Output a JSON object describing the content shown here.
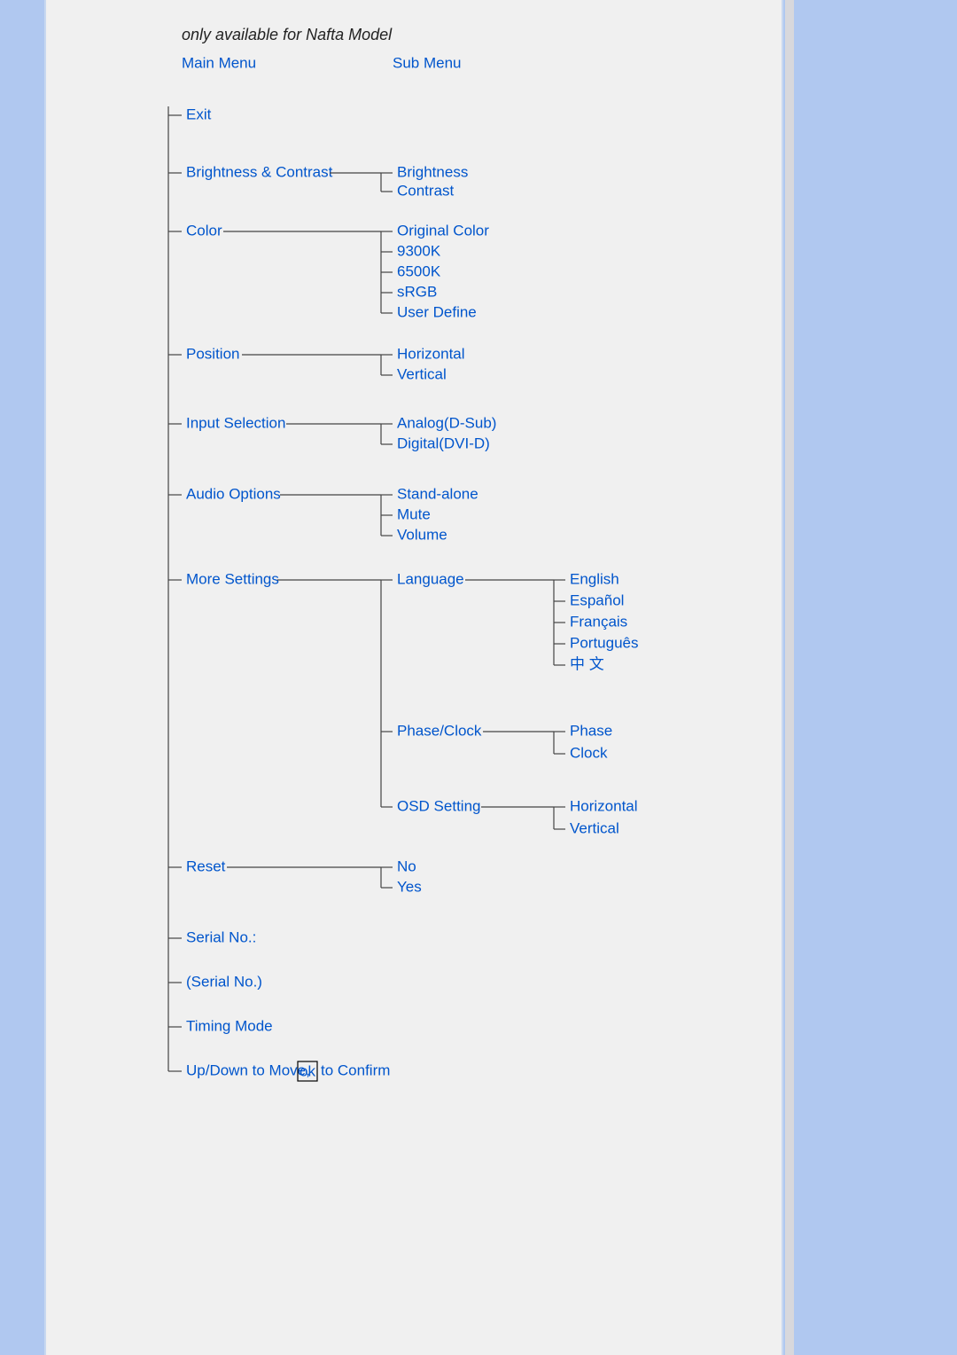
{
  "note": "only available for Nafta Model",
  "headers": {
    "main": "Main Menu",
    "sub": "Sub Menu"
  },
  "main": {
    "exit": "Exit",
    "brightness_contrast": "Brightness & Contrast",
    "color": "Color",
    "position": "Position",
    "input_selection": "Input Selection",
    "audio_options": "Audio Options",
    "more_settings": "More Settings",
    "reset": "Reset",
    "serial_no_label": "Serial No.:",
    "serial_no_value": "(Serial No.)",
    "timing_mode": "Timing Mode",
    "hint_pre": "Up/Down to Move,",
    "hint_ok": "ok",
    "hint_post": "to Confirm"
  },
  "sub": {
    "brightness": "Brightness",
    "contrast": "Contrast",
    "original_color": "Original Color",
    "c9300k": "9300K",
    "c6500k": "6500K",
    "srgb": "sRGB",
    "user_define": "User Define",
    "horizontal": "Horizontal",
    "vertical": "Vertical",
    "analog": "Analog(D-Sub)",
    "digital": "Digital(DVI-D)",
    "stand_alone": "Stand-alone",
    "mute": "Mute",
    "volume": "Volume",
    "language": "Language",
    "phase_clock": "Phase/Clock",
    "osd_setting": "OSD Setting",
    "no": "No",
    "yes": "Yes"
  },
  "lang": {
    "english": "English",
    "espanol": "Español",
    "francais": "Français",
    "portugues": "Português",
    "chinese": "中 文"
  },
  "pc": {
    "phase": "Phase",
    "clock": "Clock"
  },
  "osd": {
    "horizontal": "Horizontal",
    "vertical": "Vertical"
  }
}
